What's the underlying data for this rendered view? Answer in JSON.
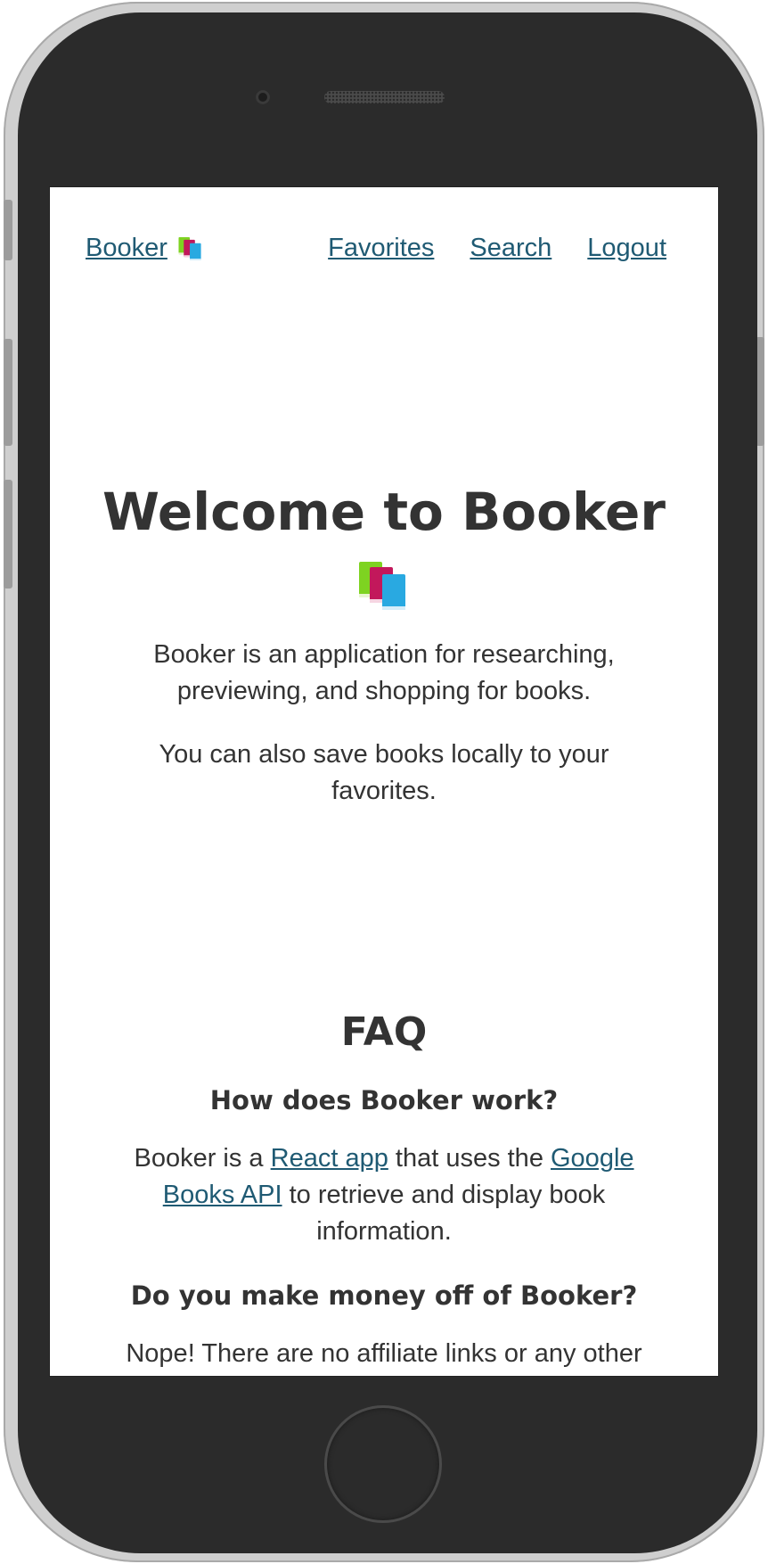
{
  "nav": {
    "brand_label": "Booker",
    "links": [
      "Favorites",
      "Search",
      "Logout"
    ]
  },
  "hero": {
    "title": "Welcome to Booker",
    "paragraphs": [
      "Booker is an application for researching, previewing, and shopping for books.",
      "You can also save books locally to your favorites."
    ]
  },
  "faq": {
    "title": "FAQ",
    "q1": "How does Booker work?",
    "a1": {
      "pre": "Booker is a ",
      "link1": "React app",
      "mid": " that uses the ",
      "link2": "Google Books API",
      "post": " to retrieve and display book information."
    },
    "q2": "Do you make money off of Booker?",
    "a2": "Nope! There are no affiliate links or any other"
  },
  "icons": {
    "brand": "books-icon"
  },
  "colors": {
    "link": "#1f5a73",
    "text": "#333333",
    "book_green": "#7ed321",
    "book_red": "#c2185b",
    "book_blue": "#29a9e1"
  }
}
